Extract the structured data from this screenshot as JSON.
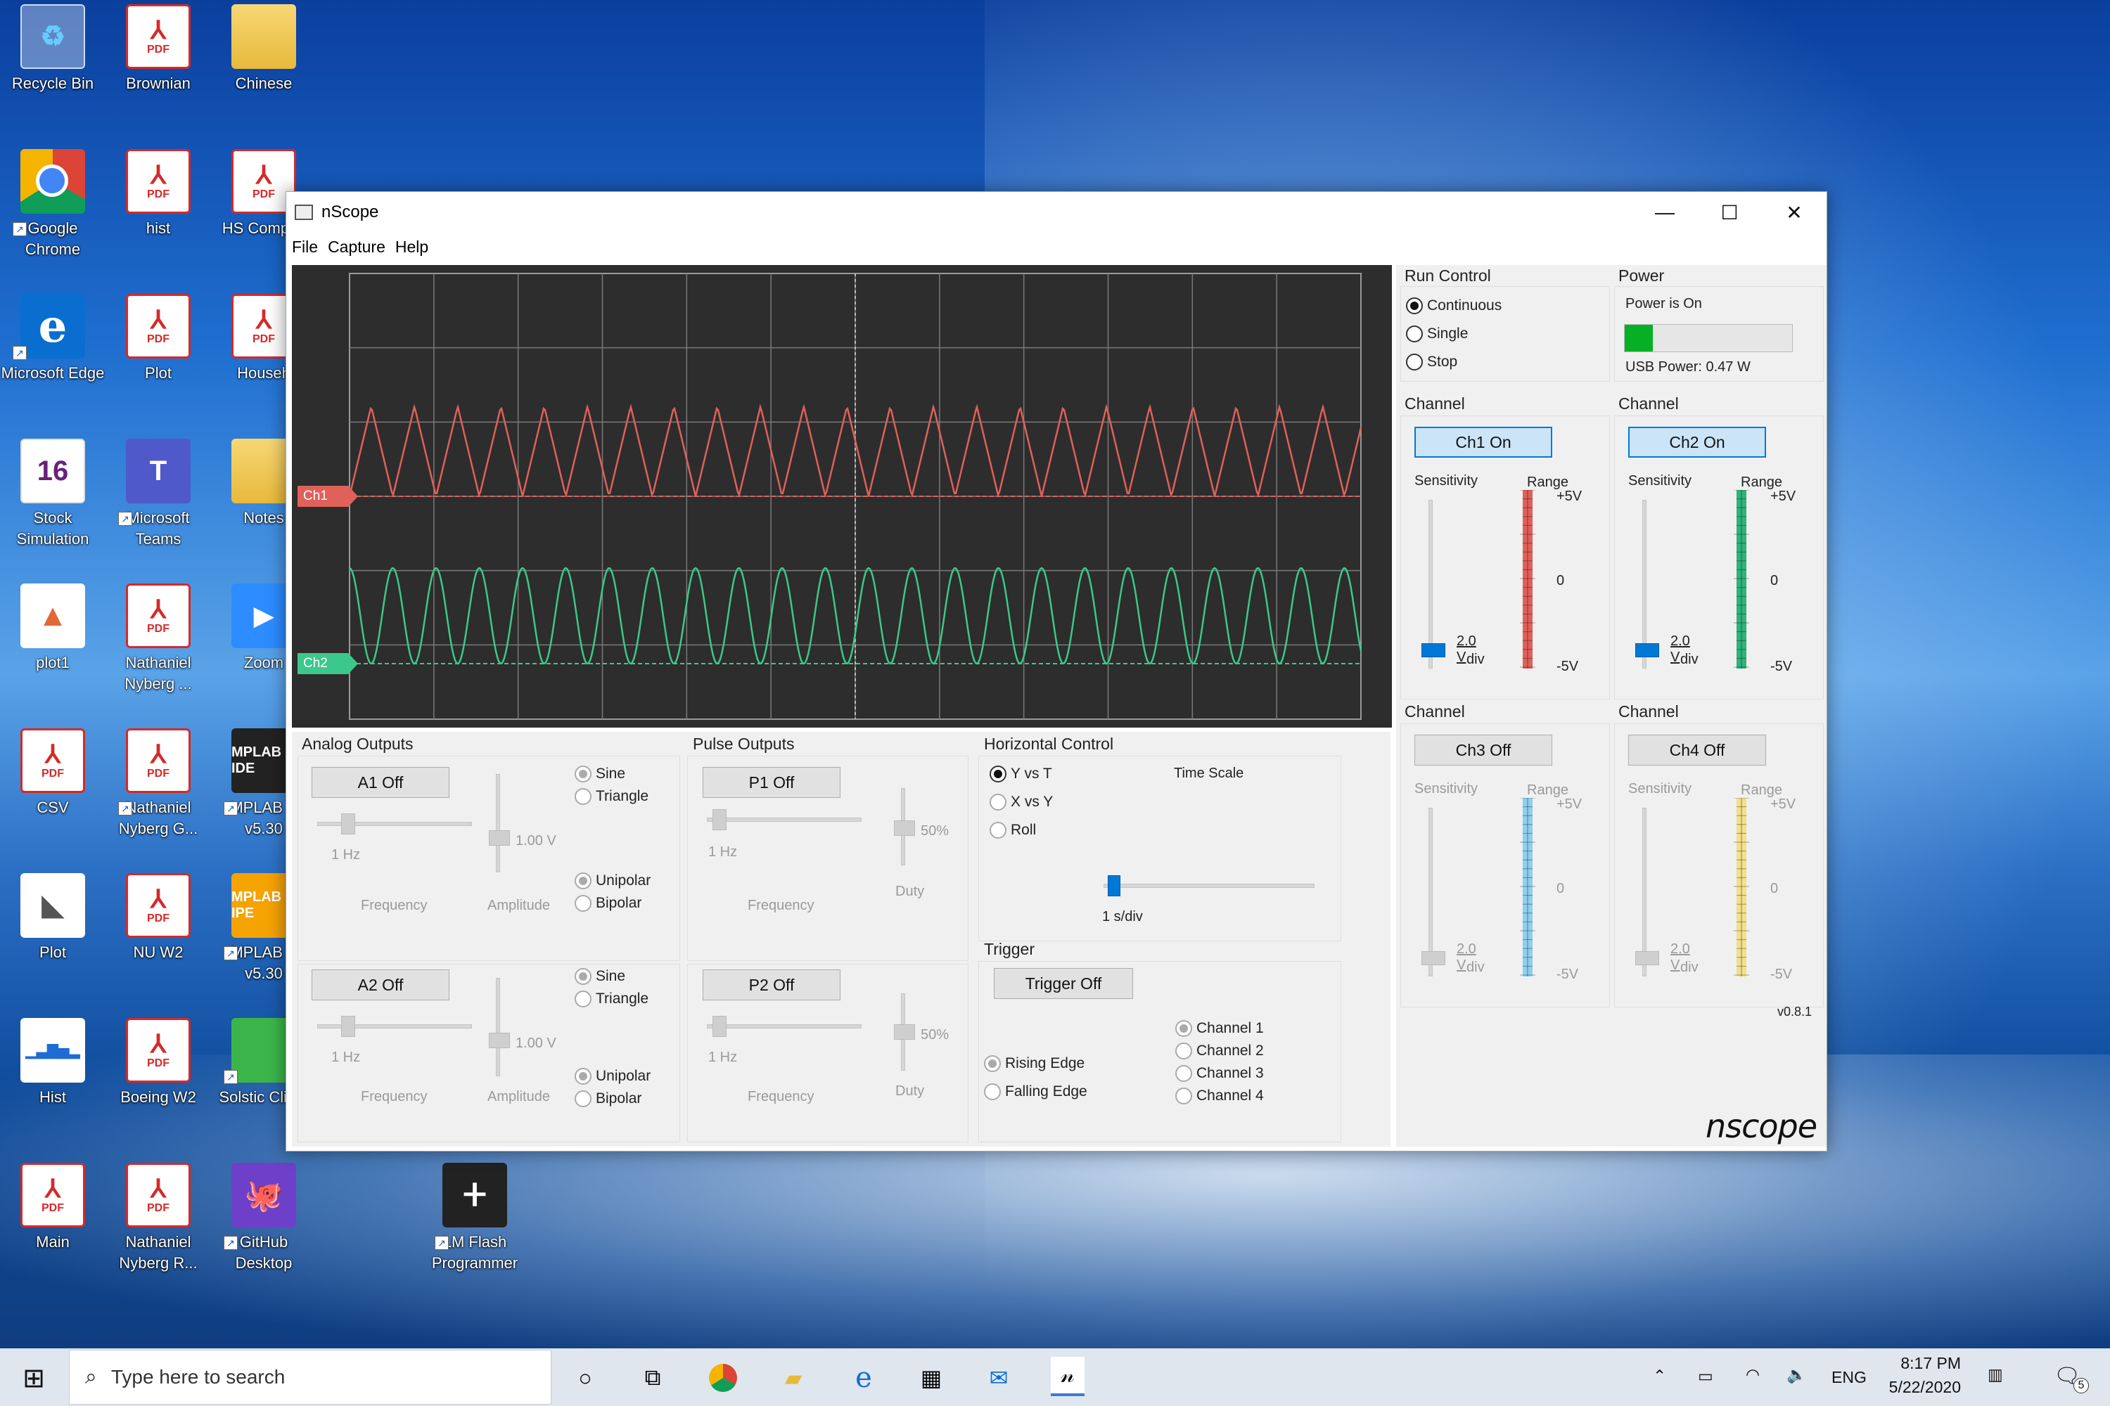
{
  "desktop": {
    "icons": [
      {
        "label": "Recycle Bin"
      },
      {
        "label": "Brownian"
      },
      {
        "label": "Chinese"
      },
      {
        "label": "Google Chrome"
      },
      {
        "label": "hist"
      },
      {
        "label": "HS Complet"
      },
      {
        "label": "Microsoft Edge"
      },
      {
        "label": "Plot"
      },
      {
        "label": "Househ"
      },
      {
        "label": "Stock Simulation"
      },
      {
        "label": "Microsoft Teams"
      },
      {
        "label": "Notes"
      },
      {
        "label": "plot1"
      },
      {
        "label": "Nathaniel Nyberg ..."
      },
      {
        "label": "Zoom"
      },
      {
        "label": "CSV"
      },
      {
        "label": "Nathaniel Nyberg G..."
      },
      {
        "label": "MPLAB X v5.30"
      },
      {
        "label": "Plot"
      },
      {
        "label": "NU W2"
      },
      {
        "label": "MPLAB X v5.30"
      },
      {
        "label": "Hist"
      },
      {
        "label": "Boeing W2"
      },
      {
        "label": "Solstic Client"
      },
      {
        "label": "Main"
      },
      {
        "label": "Nathaniel Nyberg R..."
      },
      {
        "label": "GitHub Desktop"
      },
      {
        "label": "LM Flash Programmer"
      }
    ],
    "pdf_badge": "PDF",
    "vs_badge": "16",
    "mplab_badge": "MPLAB X IDE",
    "ipe_badge": "MPLAB IPE"
  },
  "window": {
    "title": "nScope",
    "menu": [
      "File",
      "Capture",
      "Help"
    ],
    "controls": {
      "minimize": "—",
      "maximize": "☐",
      "close": "✕"
    }
  },
  "scope": {
    "ch1_tag": "Ch1",
    "ch2_tag": "Ch2",
    "ch1_color": "#e0605a",
    "ch2_color": "#3cc88c"
  },
  "analog": {
    "title": "Analog Outputs",
    "a1": {
      "button": "A1 Off",
      "freq": "1 Hz",
      "amp": "1.00 V",
      "wave": [
        "Sine",
        "Triangle"
      ],
      "polarity": [
        "Unipolar",
        "Bipolar"
      ],
      "freq_label": "Frequency",
      "amp_label": "Amplitude"
    },
    "a2": {
      "button": "A2 Off",
      "freq": "1 Hz",
      "amp": "1.00 V",
      "wave": [
        "Sine",
        "Triangle"
      ],
      "polarity": [
        "Unipolar",
        "Bipolar"
      ],
      "freq_label": "Frequency",
      "amp_label": "Amplitude"
    }
  },
  "pulse": {
    "title": "Pulse Outputs",
    "p1": {
      "button": "P1 Off",
      "freq": "1 Hz",
      "duty": "50%",
      "freq_label": "Frequency",
      "duty_label": "Duty"
    },
    "p2": {
      "button": "P2 Off",
      "freq": "1 Hz",
      "duty": "50%",
      "freq_label": "Frequency",
      "duty_label": "Duty"
    }
  },
  "horizontal": {
    "title": "Horizontal Control",
    "modes": [
      "Y vs T",
      "X vs Y",
      "Roll"
    ],
    "time_scale_label": "Time Scale",
    "time_scale_value": "1 s/div"
  },
  "trigger": {
    "title": "Trigger",
    "button": "Trigger Off",
    "edges": [
      "Rising Edge",
      "Falling Edge"
    ],
    "channels": [
      "Channel 1",
      "Channel 2",
      "Channel 3",
      "Channel 4"
    ]
  },
  "run_control": {
    "title": "Run Control",
    "options": [
      "Continuous",
      "Single",
      "Stop"
    ]
  },
  "power": {
    "title": "Power",
    "status": "Power is On",
    "usb": "USB Power: 0.47 W",
    "level": 0.17
  },
  "channels": [
    {
      "title": "Channel 1",
      "button": "Ch1 On",
      "on": true,
      "sens_label": "Sensitivity",
      "range_label": "Range",
      "div_value": "2.0 V",
      "div_unit": "div",
      "top": "+5V",
      "mid": "0",
      "bot": "-5V",
      "color": "#e0605a"
    },
    {
      "title": "Channel 2",
      "button": "Ch2 On",
      "on": true,
      "sens_label": "Sensitivity",
      "range_label": "Range",
      "div_value": "2.0 V",
      "div_unit": "div",
      "top": "+5V",
      "mid": "0",
      "bot": "-5V",
      "color": "#2fb37a"
    },
    {
      "title": "Channel 3",
      "button": "Ch3 Off",
      "on": false,
      "sens_label": "Sensitivity",
      "range_label": "Range",
      "div_value": "2.0 V",
      "div_unit": "div",
      "top": "+5V",
      "mid": "0",
      "bot": "-5V",
      "color": "#8ecfef"
    },
    {
      "title": "Channel 4",
      "button": "Ch4 Off",
      "on": false,
      "sens_label": "Sensitivity",
      "range_label": "Range",
      "div_value": "2.0 V",
      "div_unit": "div",
      "top": "+5V",
      "mid": "0",
      "bot": "-5V",
      "color": "#f2e08a"
    }
  ],
  "version": "v0.8.1",
  "logo": "nscope",
  "taskbar": {
    "search_placeholder": "Type here to search",
    "language": "ENG",
    "time": "8:17 PM",
    "date": "5/22/2020",
    "notification_count": "5"
  }
}
